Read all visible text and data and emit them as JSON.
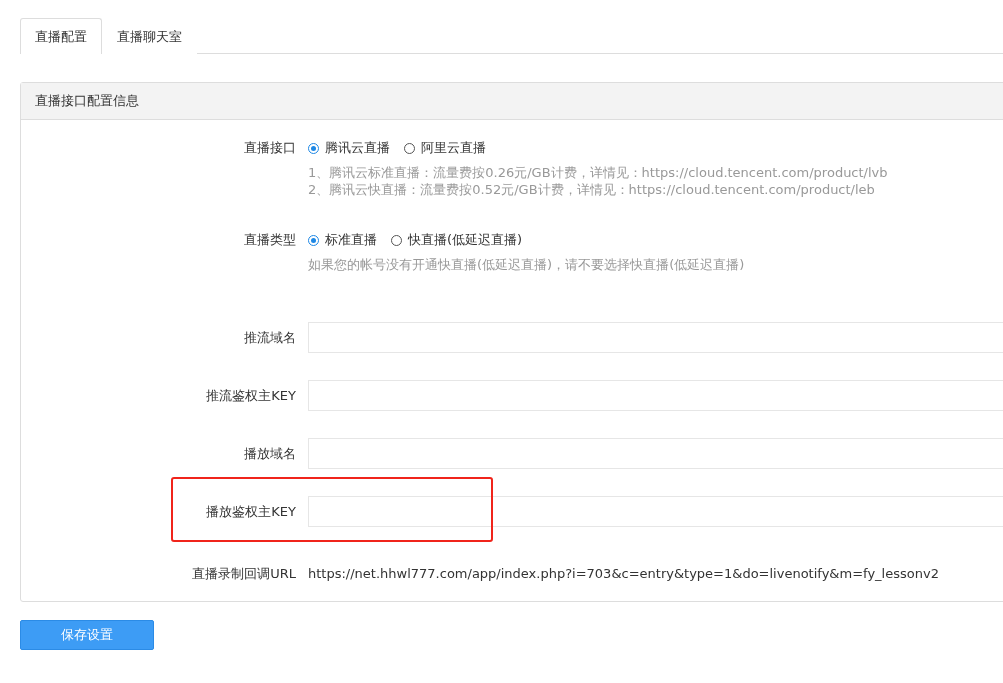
{
  "tabs": [
    {
      "label": "直播配置",
      "selected": true
    },
    {
      "label": "直播聊天室",
      "selected": false
    }
  ],
  "panel": {
    "title": "直播接口配置信息",
    "rows": [
      {
        "kind": "radio",
        "label": "直播接口",
        "options": [
          {
            "label": "腾讯云直播",
            "selected": true
          },
          {
            "label": "阿里云直播",
            "selected": false
          }
        ],
        "help": [
          "1、腾讯云标准直播：流量费按0.26元/GB计费，详情见：https://cloud.tencent.com/product/lvb",
          "2、腾讯云快直播：流量费按0.52元/GB计费，详情见：https://cloud.tencent.com/product/leb"
        ]
      },
      {
        "kind": "radio",
        "label": "直播类型",
        "options": [
          {
            "label": "标准直播",
            "selected": true
          },
          {
            "label": "快直播(低延迟直播)",
            "selected": false
          }
        ],
        "help": [
          "如果您的帐号没有开通快直播(低延迟直播)，请不要选择快直播(低延迟直播)"
        ]
      },
      {
        "kind": "input",
        "label": "推流域名"
      },
      {
        "kind": "input",
        "label": "推流鉴权主KEY"
      },
      {
        "kind": "input",
        "label": "播放域名"
      },
      {
        "kind": "input",
        "label": "播放鉴权主KEY",
        "highlighted": true
      },
      {
        "kind": "text",
        "label": "直播录制回调URL",
        "value": "https://net.hhwl777.com/app/index.php?i=703&c=entry&type=1&do=livenotify&m=fy_lessonv2"
      }
    ]
  },
  "save_button": "保存设置"
}
